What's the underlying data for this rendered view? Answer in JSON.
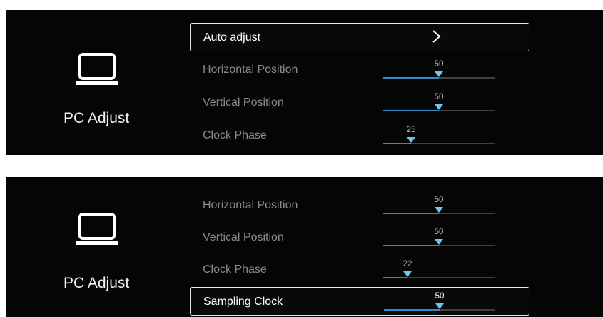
{
  "screens": [
    {
      "title": "PC Adjust",
      "icon": "monitor-icon",
      "items": [
        {
          "label": "Auto adjust",
          "type": "submenu",
          "focused": true,
          "icon": "chevron-right-icon"
        },
        {
          "label": "Horizontal Position",
          "type": "slider",
          "value": "50",
          "max": 100,
          "focused": false
        },
        {
          "label": "Vertical Position",
          "type": "slider",
          "value": "50",
          "max": 100,
          "focused": false
        },
        {
          "label": "Clock Phase",
          "type": "slider",
          "value": "25",
          "max": 100,
          "focused": false
        }
      ]
    },
    {
      "title": "PC Adjust",
      "icon": "monitor-icon",
      "items": [
        {
          "label": "Horizontal Position",
          "type": "slider",
          "value": "50",
          "max": 100,
          "focused": false
        },
        {
          "label": "Vertical Position",
          "type": "slider",
          "value": "50",
          "max": 100,
          "focused": false
        },
        {
          "label": "Clock Phase",
          "type": "slider",
          "value": "22",
          "max": 100,
          "focused": false
        },
        {
          "label": "Sampling Clock",
          "type": "slider",
          "value": "50",
          "max": 100,
          "focused": true
        }
      ]
    }
  ],
  "colors": {
    "background": "#050505",
    "accent": "#2a8fd0",
    "thumb": "#6cc6ee",
    "focus_border": "#e8e8e8",
    "text_dim": "#8a8a8a"
  }
}
